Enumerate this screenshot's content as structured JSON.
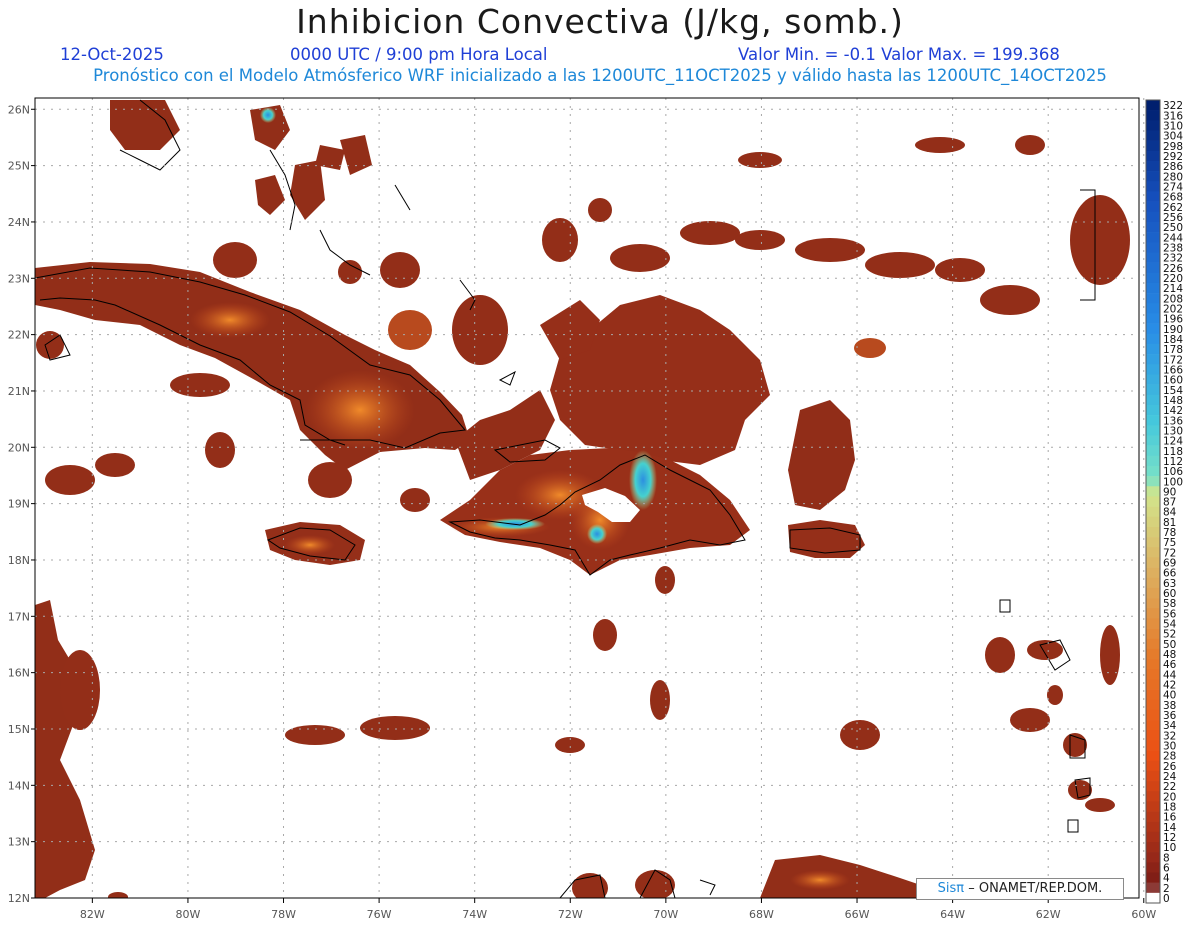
{
  "header": {
    "title": "Inhibicion Convectiva (J/kg, somb.)",
    "date": "12-Oct-2025",
    "time": "0000 UTC / 9:00 pm Hora Local",
    "min_max": "Valor Min. = -0.1  Valor Max. = 199.368",
    "description": "Pronóstico con el Modelo Atmósferico WRF inicializado a las 1200UTC_11OCT2025 y válido hasta las  1200UTC_14OCT2025"
  },
  "map": {
    "lon_range": [
      -83.2,
      -60.1
    ],
    "lat_range": [
      12,
      26.2
    ],
    "lon_ticks": [
      "82W",
      "80W",
      "78W",
      "76W",
      "74W",
      "72W",
      "70W",
      "68W",
      "66W",
      "64W",
      "62W",
      "60W"
    ],
    "lat_ticks": [
      "12N",
      "13N",
      "14N",
      "15N",
      "16N",
      "17N",
      "18N",
      "19N",
      "20N",
      "21N",
      "22N",
      "23N",
      "24N",
      "25N",
      "26N"
    ]
  },
  "colorbar": {
    "labels": [
      "322",
      "316",
      "310",
      "304",
      "298",
      "292",
      "286",
      "280",
      "274",
      "268",
      "262",
      "256",
      "250",
      "244",
      "238",
      "232",
      "226",
      "220",
      "214",
      "208",
      "202",
      "196",
      "190",
      "184",
      "178",
      "172",
      "166",
      "160",
      "154",
      "148",
      "142",
      "136",
      "130",
      "124",
      "118",
      "112",
      "106",
      "100",
      "90",
      "87",
      "84",
      "81",
      "78",
      "75",
      "72",
      "69",
      "66",
      "63",
      "60",
      "58",
      "56",
      "54",
      "52",
      "50",
      "48",
      "46",
      "44",
      "42",
      "40",
      "38",
      "36",
      "34",
      "32",
      "30",
      "28",
      "26",
      "24",
      "22",
      "20",
      "18",
      "16",
      "14",
      "12",
      "10",
      "8",
      "6",
      "4",
      "2",
      "0"
    ]
  },
  "credit": {
    "logo_text": "Sisπ",
    "text": "– ONAMET/REP.DOM."
  },
  "colors": {
    "field_base": "#8f2e1a",
    "field_warm": "#d35a1c",
    "field_hot": "#f07a22",
    "field_cyan": "#33c7d6",
    "field_blue": "#2c8fe0",
    "coast": "#000000",
    "grid": "#a8a8a8"
  }
}
